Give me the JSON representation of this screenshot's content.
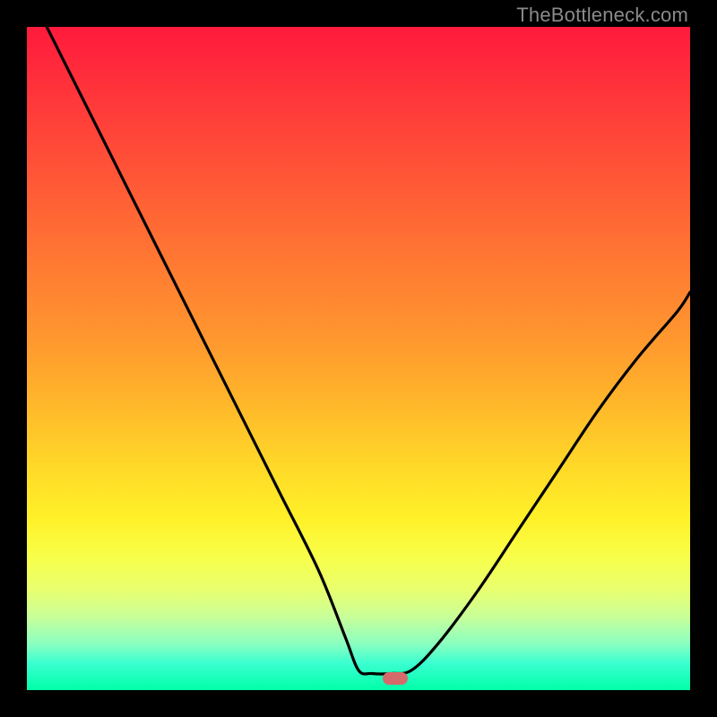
{
  "watermark": {
    "text": "TheBottleneck.com"
  },
  "chart_data": {
    "type": "line",
    "title": "",
    "xlabel": "",
    "ylabel": "",
    "xlim": [
      0,
      1
    ],
    "ylim": [
      0,
      1
    ],
    "curve_points": [
      {
        "x": 0.03,
        "y": 1.0
      },
      {
        "x": 0.08,
        "y": 0.9
      },
      {
        "x": 0.14,
        "y": 0.78
      },
      {
        "x": 0.2,
        "y": 0.66
      },
      {
        "x": 0.26,
        "y": 0.54
      },
      {
        "x": 0.32,
        "y": 0.42
      },
      {
        "x": 0.38,
        "y": 0.3
      },
      {
        "x": 0.44,
        "y": 0.18
      },
      {
        "x": 0.48,
        "y": 0.08
      },
      {
        "x": 0.5,
        "y": 0.03
      },
      {
        "x": 0.52,
        "y": 0.025
      },
      {
        "x": 0.55,
        "y": 0.025
      },
      {
        "x": 0.58,
        "y": 0.03
      },
      {
        "x": 0.62,
        "y": 0.07
      },
      {
        "x": 0.68,
        "y": 0.15
      },
      {
        "x": 0.74,
        "y": 0.24
      },
      {
        "x": 0.8,
        "y": 0.33
      },
      {
        "x": 0.86,
        "y": 0.42
      },
      {
        "x": 0.92,
        "y": 0.5
      },
      {
        "x": 0.98,
        "y": 0.57
      },
      {
        "x": 1.0,
        "y": 0.6
      }
    ],
    "marker": {
      "x": 0.555,
      "y": 0.018,
      "color": "#d46a6a"
    },
    "gradient_stops": [
      {
        "pos": 0.0,
        "color": "#ff1a3c"
      },
      {
        "pos": 0.5,
        "color": "#ffbb2a"
      },
      {
        "pos": 0.8,
        "color": "#f8ff4a"
      },
      {
        "pos": 1.0,
        "color": "#00ffa8"
      }
    ]
  }
}
